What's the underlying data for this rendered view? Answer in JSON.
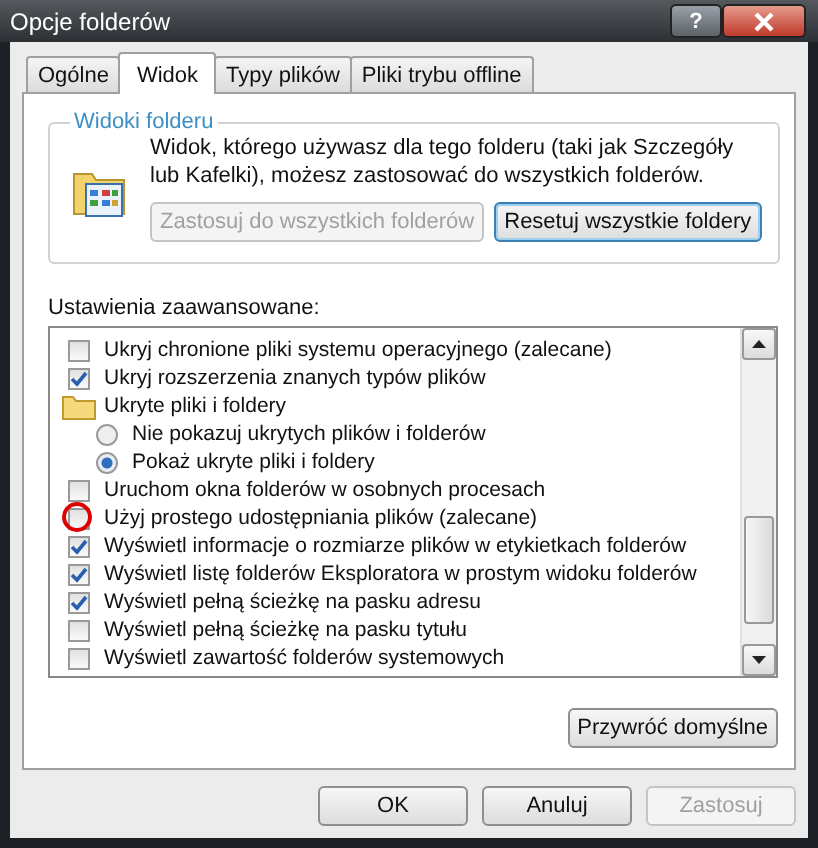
{
  "window": {
    "title": "Opcje folderów",
    "help": "?"
  },
  "tabs": [
    {
      "label": "Ogólne",
      "selected": false
    },
    {
      "label": "Widok",
      "selected": true
    },
    {
      "label": "Typy plików",
      "selected": false
    },
    {
      "label": "Pliki trybu offline",
      "selected": false
    }
  ],
  "folder_views": {
    "title": "Widoki folderu",
    "description": "Widok, którego używasz dla tego folderu (taki jak Szczegóły lub Kafelki), możesz zastosować do wszystkich folderów.",
    "buttons": [
      {
        "label": "Zastosuj do wszystkich folderów",
        "disabled": true
      },
      {
        "label": "Resetuj wszystkie foldery",
        "disabled": false
      }
    ]
  },
  "advanced": {
    "label": "Ustawienia zaawansowane:",
    "items": [
      {
        "kind": "checkbox",
        "label": "Ukryj chronione pliki systemu operacyjnego (zalecane)",
        "checked": false,
        "circled": false
      },
      {
        "kind": "checkbox",
        "label": "Ukryj rozszerzenia znanych typów plików",
        "checked": true,
        "circled": false
      },
      {
        "kind": "folder",
        "label": "Ukryte pliki i foldery",
        "circled": false,
        "children": [
          {
            "kind": "radio",
            "label": "Nie pokazuj ukrytych plików i folderów",
            "selected": false,
            "circled": false
          },
          {
            "kind": "radio",
            "label": "Pokaż ukryte pliki i foldery",
            "selected": true,
            "circled": false
          }
        ]
      },
      {
        "kind": "checkbox",
        "label": "Uruchom okna folderów w osobnych procesach",
        "checked": false,
        "circled": false
      },
      {
        "kind": "checkbox",
        "label": "Użyj prostego udostępniania plików (zalecane)",
        "checked": false,
        "circled": true
      },
      {
        "kind": "checkbox",
        "label": "Wyświetl informacje o rozmiarze plików w etykietkach folderów",
        "checked": true,
        "circled": false
      },
      {
        "kind": "checkbox",
        "label": "Wyświetl listę folderów Eksploratora w prostym widoku folderów",
        "checked": true,
        "circled": false
      },
      {
        "kind": "checkbox",
        "label": "Wyświetl pełną ścieżkę na pasku adresu",
        "checked": true,
        "circled": false
      },
      {
        "kind": "checkbox",
        "label": "Wyświetl pełną ścieżkę na pasku tytułu",
        "checked": false,
        "circled": false
      },
      {
        "kind": "checkbox",
        "label": "Wyświetl zawartość folderów systemowych",
        "checked": false,
        "circled": false
      }
    ]
  },
  "restore_button": {
    "label": "Przywróć domyślne",
    "disabled": false
  },
  "buttons": [
    {
      "label": "OK",
      "disabled": false
    },
    {
      "label": "Anuluj",
      "disabled": false
    },
    {
      "label": "Zastosuj",
      "disabled": true
    }
  ]
}
